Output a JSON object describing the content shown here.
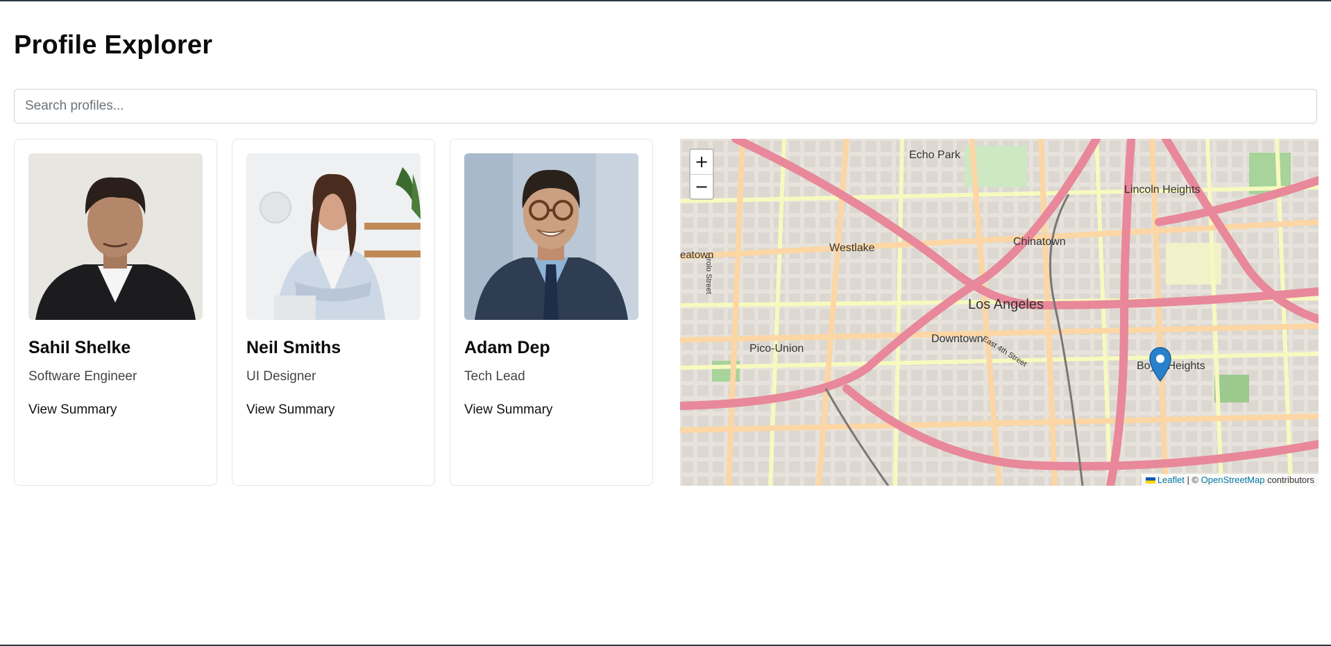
{
  "page": {
    "title": "Profile Explorer"
  },
  "search": {
    "placeholder": "Search profiles..."
  },
  "profiles": [
    {
      "name": "Sahil Shelke",
      "role": "Software Engineer",
      "link": "View Summary"
    },
    {
      "name": "Neil Smiths",
      "role": "UI Designer",
      "link": "View Summary"
    },
    {
      "name": "Adam Dep",
      "role": "Tech Lead",
      "link": "View Summary"
    }
  ],
  "map": {
    "zoom_in": "+",
    "zoom_out": "−",
    "labels": {
      "echo_park": "Echo Park",
      "lincoln_heights": "Lincoln Heights",
      "chinatown": "Chinatown",
      "westlake": "Westlake",
      "los_angeles": "Los Angeles",
      "downtown": "Downtown",
      "pico_union": "Pico-Union",
      "boyle_heights": "Boyle Heights",
      "east_4th": "East 4th Street",
      "irolo": "Irolo Street",
      "koreatown": "eatown"
    },
    "attribution": {
      "leaflet": "Leaflet",
      "separator": " | © ",
      "osm": "OpenStreetMap",
      "suffix": " contributors"
    },
    "colors": {
      "highway": "#e8889a",
      "primary": "#fcd6a4",
      "secondary": "#f7fabf",
      "marker": "#2a81cb"
    }
  }
}
